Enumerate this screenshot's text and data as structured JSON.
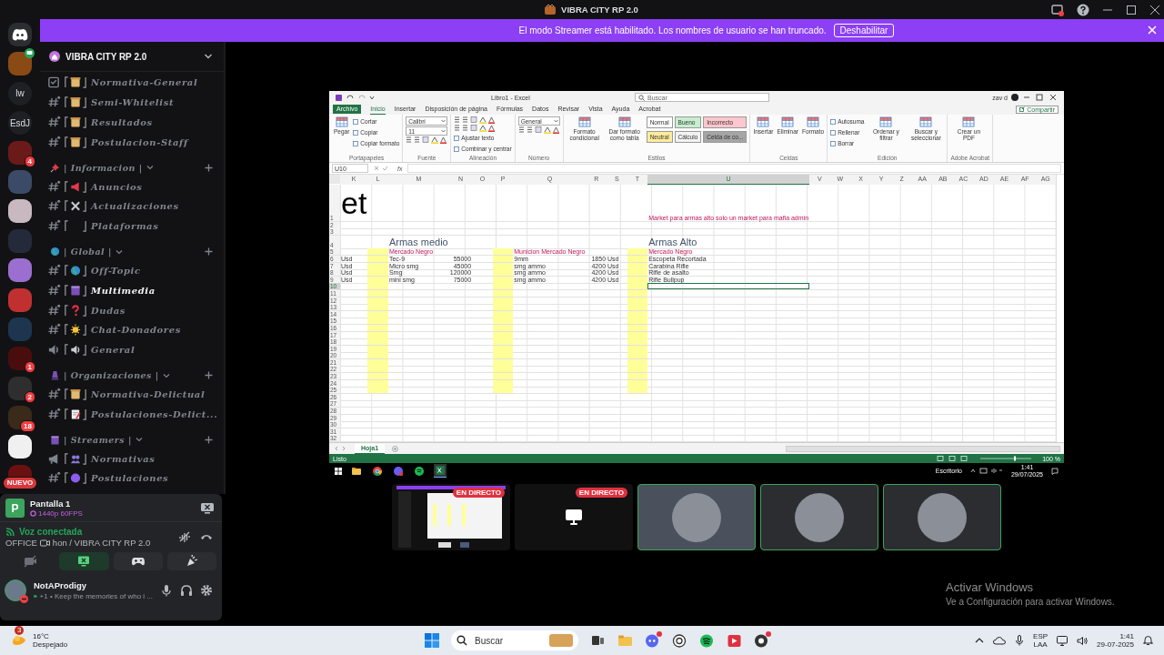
{
  "app_title": "VIBRA CITY RP 2.0",
  "streamer_banner": {
    "text": "El modo Streamer está habilitado. Los nombres de usuario se han truncado.",
    "button": "Deshabilitar"
  },
  "server_rail": [
    {
      "kind": "home"
    },
    {
      "kind": "server",
      "color": "#8a4a14",
      "voice_badge": true
    },
    {
      "kind": "text",
      "label": "lw"
    },
    {
      "kind": "text",
      "label": "EsdJ"
    },
    {
      "kind": "server",
      "color": "#6b1a1a",
      "badge": "4"
    },
    {
      "kind": "server",
      "color": "#3b4a66"
    },
    {
      "kind": "server",
      "color": "#c8b8c0"
    },
    {
      "kind": "server",
      "color": "#252a3a"
    },
    {
      "kind": "server",
      "color": "#9a6fd0"
    },
    {
      "kind": "server",
      "color": "#c03030"
    },
    {
      "kind": "server",
      "color": "#1e3550"
    },
    {
      "kind": "server",
      "color": "#4a0d0d",
      "badge": "1"
    },
    {
      "kind": "server",
      "color": "#2e2e2e",
      "badge": "2"
    },
    {
      "kind": "server",
      "color": "#3a2a1a",
      "badge": "18"
    },
    {
      "kind": "server",
      "color": "#f0f0f0"
    },
    {
      "kind": "server",
      "color": "#6a1010",
      "pill": "NUEVO"
    }
  ],
  "server_header": {
    "name": "VIBRA CITY RP 2.0"
  },
  "channel_groups": [
    {
      "channels": [
        {
          "kind": "rules",
          "icon": {
            "kind": "scroll"
          },
          "name": "Normativa-General",
          "selected": false
        },
        {
          "kind": "text",
          "icon": {
            "kind": "scroll"
          },
          "name": "Semi-Whitelist",
          "selected": false
        },
        {
          "kind": "text",
          "icon": {
            "kind": "scroll"
          },
          "name": "Resultados",
          "selected": false
        },
        {
          "kind": "text",
          "icon": {
            "kind": "scroll"
          },
          "name": "Postulacion-Staff",
          "selected": false
        }
      ]
    },
    {
      "category": {
        "name": "| Informacion |",
        "icon": {
          "kind": "pin"
        }
      },
      "channels": [
        {
          "kind": "text",
          "icon": {
            "kind": "megaphone"
          },
          "name": "Anuncios",
          "selected": false
        },
        {
          "kind": "text",
          "icon": {
            "kind": "tools"
          },
          "name": "Actualizaciones",
          "selected": false
        },
        {
          "kind": "text",
          "icon": {
            "kind": "empty"
          },
          "name": "Plataformas",
          "selected": false
        }
      ]
    },
    {
      "category": {
        "name": "| Global |",
        "icon": {
          "kind": "globe"
        }
      },
      "channels": [
        {
          "kind": "text",
          "icon": {
            "kind": "globe"
          },
          "name": "Off-Topic",
          "selected": false
        },
        {
          "kind": "text",
          "icon": {
            "kind": "clapper"
          },
          "name": "Multimedia",
          "selected": true
        },
        {
          "kind": "text",
          "icon": {
            "kind": "question"
          },
          "name": "Dudas",
          "selected": false
        },
        {
          "kind": "text",
          "icon": {
            "kind": "sun"
          },
          "name": "Chat-Donadores",
          "selected": false
        },
        {
          "kind": "voice",
          "icon": {
            "kind": "speaker"
          },
          "name": "General",
          "selected": false
        }
      ]
    },
    {
      "category": {
        "name": "| Organizaciones |",
        "icon": {
          "kind": "lamp"
        }
      },
      "channels": [
        {
          "kind": "text",
          "icon": {
            "kind": "scroll"
          },
          "name": "Normativa-Delictual",
          "selected": false
        },
        {
          "kind": "text",
          "icon": {
            "kind": "page"
          },
          "name": "Postulaciones-Delict...",
          "selected": false
        }
      ]
    },
    {
      "category": {
        "name": "| Streamers |",
        "icon": {
          "kind": "clapper"
        }
      },
      "channels": [
        {
          "kind": "stage",
          "icon": {
            "kind": "people"
          },
          "name": "Normativas",
          "selected": false
        },
        {
          "kind": "text",
          "icon": {
            "kind": "circle"
          },
          "name": "Postulaciones",
          "selected": false
        }
      ]
    }
  ],
  "stream": {
    "icon_letter": "P",
    "title": "Pantalla 1",
    "quality": "1440p 60FPS"
  },
  "voice": {
    "status": "Voz conectada",
    "channel": "OFFICE",
    "channel_suffix": "hon / VIBRA CITY RP 2.0"
  },
  "voice_buttons": [
    {
      "kind": "camera",
      "on": false
    },
    {
      "kind": "screen",
      "on": true
    },
    {
      "kind": "activity",
      "on": false
    },
    {
      "kind": "soundboard",
      "on": false
    }
  ],
  "user": {
    "name": "NotAProdigy",
    "status": "+1 • Keep the memories of who i ..."
  },
  "excel": {
    "title": "Libro1 - Excel",
    "search": "Buscar",
    "account": "zav d",
    "share": "Compartir",
    "tabs": [
      {
        "label": "Archivo",
        "selected": false
      },
      {
        "label": "Inicio",
        "selected": true
      },
      {
        "label": "Insertar",
        "selected": false
      },
      {
        "label": "Disposición de página",
        "selected": false
      },
      {
        "label": "Fórmulas",
        "selected": false
      },
      {
        "label": "Datos",
        "selected": false
      },
      {
        "label": "Revisar",
        "selected": false
      },
      {
        "label": "Vista",
        "selected": false
      },
      {
        "label": "Ayuda",
        "selected": false
      },
      {
        "label": "Acrobat",
        "selected": false
      }
    ],
    "ribbon_groups": [
      {
        "label": "Portapapeles",
        "items": [
          {
            "kind": "large",
            "label": "Pegar"
          },
          {
            "kind": "small",
            "label": "Cortar"
          },
          {
            "kind": "small",
            "label": "Copiar"
          },
          {
            "kind": "small",
            "label": "Copiar formato"
          }
        ]
      },
      {
        "label": "Fuente",
        "items": [
          {
            "kind": "combo",
            "label": "Calibri"
          },
          {
            "kind": "combo",
            "label": "11"
          },
          {
            "kind": "tools"
          }
        ]
      },
      {
        "label": "Alineación",
        "items": [
          {
            "kind": "tools"
          },
          {
            "kind": "tools"
          },
          {
            "kind": "small",
            "label": "Ajustar texto"
          },
          {
            "kind": "small",
            "label": "Combinar y centrar"
          }
        ]
      },
      {
        "label": "Número",
        "items": [
          {
            "kind": "combo",
            "label": "General"
          },
          {
            "kind": "tools"
          }
        ]
      },
      {
        "label": "Estilos",
        "items": [
          {
            "kind": "large",
            "label": "Formato condicional"
          },
          {
            "kind": "large",
            "label": "Dar formato como tabla"
          },
          {
            "kind": "style",
            "label": "Normal",
            "color": "#ffffff"
          },
          {
            "kind": "style",
            "label": "Bueno",
            "color": "#c6efce"
          },
          {
            "kind": "style",
            "label": "Incorrecto",
            "color": "#ffc7ce"
          },
          {
            "kind": "style",
            "label": "Neutral",
            "color": "#ffeb9c"
          },
          {
            "kind": "style",
            "label": "Cálculo",
            "color": "#f2f2f2"
          },
          {
            "kind": "style",
            "label": "Celda de co...",
            "color": "#a5a5a5"
          }
        ]
      },
      {
        "label": "Celdas",
        "items": [
          {
            "kind": "large",
            "label": "Insertar"
          },
          {
            "kind": "large",
            "label": "Eliminar"
          },
          {
            "kind": "large",
            "label": "Formato"
          }
        ]
      },
      {
        "label": "Edición",
        "items": [
          {
            "kind": "small",
            "label": "Autosuma"
          },
          {
            "kind": "small",
            "label": "Rellenar"
          },
          {
            "kind": "small",
            "label": "Borrar"
          },
          {
            "kind": "large",
            "label": "Ordenar y filtrar"
          },
          {
            "kind": "large",
            "label": "Buscar y seleccionar"
          }
        ]
      },
      {
        "label": "Adobe Acrobat",
        "items": [
          {
            "kind": "large",
            "label": "Crear un PDF"
          }
        ]
      }
    ],
    "name_box": "U10",
    "formula_label": "fx",
    "columns": [
      {
        "label": "K",
        "selected": false,
        "highlighted": false
      },
      {
        "label": "L",
        "selected": false,
        "highlighted": true
      },
      {
        "label": "M",
        "selected": false,
        "highlighted": false
      },
      {
        "label": "N",
        "selected": false,
        "highlighted": false
      },
      {
        "label": "O",
        "selected": false,
        "highlighted": false
      },
      {
        "label": "P",
        "selected": false,
        "highlighted": true
      },
      {
        "label": "Q",
        "selected": false,
        "highlighted": false
      },
      {
        "label": "R",
        "selected": false,
        "highlighted": false
      },
      {
        "label": "S",
        "selected": false,
        "highlighted": false
      },
      {
        "label": "T",
        "selected": false,
        "highlighted": true
      },
      {
        "label": "U",
        "selected": true,
        "highlighted": false
      },
      {
        "label": "V",
        "selected": false,
        "highlighted": false
      },
      {
        "label": "W",
        "selected": false,
        "highlighted": false
      },
      {
        "label": "X",
        "selected": false,
        "highlighted": false
      },
      {
        "label": "Y",
        "selected": false,
        "highlighted": false
      },
      {
        "label": "Z",
        "selected": false,
        "highlighted": false
      },
      {
        "label": "AA",
        "selected": false,
        "highlighted": false
      },
      {
        "label": "AB",
        "selected": false,
        "highlighted": false
      },
      {
        "label": "AC",
        "selected": false,
        "highlighted": false
      },
      {
        "label": "AD",
        "selected": false,
        "highlighted": false
      },
      {
        "label": "AE",
        "selected": false,
        "highlighted": false
      },
      {
        "label": "AF",
        "selected": false,
        "highlighted": false
      },
      {
        "label": "AG",
        "selected": false,
        "highlighted": false
      }
    ],
    "rows": [
      {
        "number": "1",
        "selected": false,
        "highlighted": false,
        "cells": {
          "K": {
            "kind": "title",
            "text": "et",
            "selected": false
          },
          "U": {
            "kind": "note",
            "text": "Market para armas alto solo un market para mafia admin",
            "selected": false
          }
        }
      },
      {
        "number": "2",
        "selected": false,
        "highlighted": false
      },
      {
        "number": "3",
        "selected": false,
        "highlighted": false
      },
      {
        "number": "4",
        "selected": false,
        "highlighted": false,
        "cells": {
          "M": {
            "kind": "heading",
            "text": "Armas medio",
            "selected": false
          },
          "U": {
            "kind": "heading",
            "text": "Armas Alto",
            "selected": false
          }
        }
      },
      {
        "number": "5",
        "selected": false,
        "highlighted": true,
        "cells": {
          "M": {
            "kind": "note",
            "text": "Mercado Negro",
            "selected": false
          },
          "Q": {
            "kind": "note",
            "text": "Municion Mercado Negro",
            "selected": false
          },
          "U": {
            "kind": "note",
            "text": "Mercado Negro",
            "selected": false
          }
        }
      },
      {
        "number": "6",
        "selected": false,
        "highlighted": true,
        "cells": {
          "K": {
            "kind": "text",
            "text": "Usd",
            "selected": false
          },
          "M": {
            "kind": "text",
            "text": "Tec-9",
            "selected": false
          },
          "N": {
            "kind": "number",
            "text": "55000",
            "selected": false
          },
          "Q": {
            "kind": "text",
            "text": "9mm",
            "selected": false
          },
          "R": {
            "kind": "number",
            "text": "1850",
            "selected": false
          },
          "S": {
            "kind": "text",
            "text": "Usd",
            "selected": false
          },
          "U": {
            "kind": "text",
            "text": "Escopeta Recortada",
            "selected": false
          }
        }
      },
      {
        "number": "7",
        "selected": false,
        "highlighted": true,
        "cells": {
          "K": {
            "kind": "text",
            "text": "Usd",
            "selected": false
          },
          "M": {
            "kind": "text",
            "text": "Micro smg",
            "selected": false
          },
          "N": {
            "kind": "number",
            "text": "45000",
            "selected": false
          },
          "Q": {
            "kind": "text",
            "text": "smg ammo",
            "selected": false
          },
          "R": {
            "kind": "number",
            "text": "4200",
            "selected": false
          },
          "S": {
            "kind": "text",
            "text": "Usd",
            "selected": false
          },
          "U": {
            "kind": "text",
            "text": "Carabina Rifle",
            "selected": false
          }
        }
      },
      {
        "number": "8",
        "selected": false,
        "highlighted": true,
        "cells": {
          "K": {
            "kind": "text",
            "text": "Usd",
            "selected": false
          },
          "M": {
            "kind": "text",
            "text": "Smg",
            "selected": false
          },
          "N": {
            "kind": "number",
            "text": "120000",
            "selected": false
          },
          "Q": {
            "kind": "text",
            "text": "smg ammo",
            "selected": false
          },
          "R": {
            "kind": "number",
            "text": "4200",
            "selected": false
          },
          "S": {
            "kind": "text",
            "text": "Usd",
            "selected": false
          },
          "U": {
            "kind": "text",
            "text": "Rifle de asalto",
            "selected": false
          }
        }
      },
      {
        "number": "9",
        "selected": false,
        "highlighted": true,
        "cells": {
          "K": {
            "kind": "text",
            "text": "Usd",
            "selected": false
          },
          "M": {
            "kind": "text",
            "text": "mini smg",
            "selected": false
          },
          "N": {
            "kind": "number",
            "text": "75000",
            "selected": false
          },
          "Q": {
            "kind": "text",
            "text": "smg ammo",
            "selected": false
          },
          "R": {
            "kind": "number",
            "text": "4200",
            "selected": false
          },
          "S": {
            "kind": "text",
            "text": "Usd",
            "selected": false
          },
          "U": {
            "kind": "text",
            "text": "Rifle Bullpup",
            "selected": false
          }
        }
      },
      {
        "number": "10",
        "selected": true,
        "highlighted": true,
        "cells": {
          "U": {
            "kind": "empty",
            "selected": true
          }
        }
      },
      {
        "number": "11",
        "selected": false,
        "highlighted": true
      },
      {
        "number": "12",
        "selected": false,
        "highlighted": true
      },
      {
        "number": "13",
        "selected": false,
        "highlighted": true
      },
      {
        "number": "14",
        "selected": false,
        "highlighted": true
      },
      {
        "number": "15",
        "selected": false,
        "highlighted": true
      },
      {
        "number": "16",
        "selected": false,
        "highlighted": true
      },
      {
        "number": "17",
        "selected": false,
        "highlighted": true
      },
      {
        "number": "18",
        "selected": false,
        "highlighted": true
      },
      {
        "number": "19",
        "selected": false,
        "highlighted": true
      },
      {
        "number": "20",
        "selected": false,
        "highlighted": true
      },
      {
        "number": "21",
        "selected": false,
        "highlighted": true
      },
      {
        "number": "22",
        "selected": false,
        "highlighted": true
      },
      {
        "number": "23",
        "selected": false,
        "highlighted": true
      },
      {
        "number": "24",
        "selected": false,
        "highlighted": true
      },
      {
        "number": "25",
        "selected": false,
        "highlighted": true
      },
      {
        "number": "26",
        "selected": false,
        "highlighted": false
      },
      {
        "number": "27",
        "selected": false,
        "highlighted": false
      },
      {
        "number": "28",
        "selected": false,
        "highlighted": false
      },
      {
        "number": "29",
        "selected": false,
        "highlighted": false
      },
      {
        "number": "30",
        "selected": false,
        "highlighted": false
      },
      {
        "number": "31",
        "selected": false,
        "highlighted": false
      },
      {
        "number": "32",
        "selected": false,
        "highlighted": false
      }
    ],
    "sheet_tabs": [
      {
        "label": "Hoja1",
        "selected": true
      }
    ],
    "status": "Listo",
    "zoom": "100 %"
  },
  "inner_taskbar": {
    "apps": [
      {
        "kind": "folder",
        "selected": false
      },
      {
        "kind": "browser",
        "selected": false
      },
      {
        "kind": "chat",
        "selected": false
      },
      {
        "kind": "music",
        "selected": false
      },
      {
        "kind": "sheet",
        "selected": true
      }
    ],
    "desktop_label": "Escritorio",
    "time": "1:41",
    "date": "29/07/2025"
  },
  "stream_tiles": [
    {
      "kind": "screen",
      "live": "EN DIRECTO",
      "selected": false,
      "speaking": false
    },
    {
      "kind": "screen_off",
      "live": "EN DIRECTO",
      "selected": false,
      "speaking": false
    },
    {
      "kind": "avatar",
      "selected": true,
      "speaking": true
    },
    {
      "kind": "avatar",
      "selected": false,
      "speaking": true
    },
    {
      "kind": "avatar",
      "selected": false,
      "speaking": true
    }
  ],
  "activation_notice": {
    "title": "Activar Windows",
    "text": "Ve a Configuración para activar Windows."
  },
  "taskbar": {
    "weather": {
      "badge": "3",
      "temperature": "16°C",
      "condition": "Despejado"
    },
    "search": "Buscar",
    "apps": [
      {
        "kind": "taskview",
        "alert": false
      },
      {
        "kind": "folder",
        "alert": false
      },
      {
        "kind": "chat",
        "alert": true
      },
      {
        "kind": "ring",
        "alert": false
      },
      {
        "kind": "music",
        "alert": false
      },
      {
        "kind": "play",
        "alert": false
      },
      {
        "kind": "record",
        "alert": true
      }
    ],
    "language": "ESP",
    "layout": "LAA",
    "time": "1:41",
    "date": "29-07-2025"
  }
}
